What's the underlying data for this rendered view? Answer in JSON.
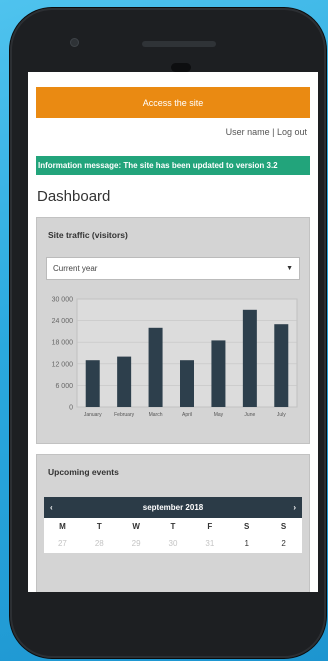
{
  "header": {
    "access_label": "Access the site"
  },
  "user": {
    "name_label": "User name",
    "logout_label": "Log out"
  },
  "info": {
    "message": "Information message: The site has been updated to version 3.2"
  },
  "dashboard": {
    "title": "Dashboard"
  },
  "traffic": {
    "title": "Site traffic (visitors)",
    "period_selected": "Current year"
  },
  "events": {
    "title": "Upcoming events"
  },
  "calendar": {
    "month": "september 2018",
    "prev": "‹",
    "next": "›",
    "weekdays": [
      "M",
      "T",
      "W",
      "T",
      "F",
      "S",
      "S"
    ],
    "days": [
      {
        "d": "27",
        "out": true
      },
      {
        "d": "28",
        "out": true
      },
      {
        "d": "29",
        "out": true
      },
      {
        "d": "30",
        "out": true
      },
      {
        "d": "31",
        "out": true
      },
      {
        "d": "1",
        "out": false
      },
      {
        "d": "2",
        "out": false
      }
    ]
  },
  "colors": {
    "accent": "#ea8a12",
    "info": "#22a47b",
    "bar": "#2d3f4c",
    "calendar_header": "#2b3b47"
  },
  "chart_data": {
    "type": "bar",
    "categories": [
      "January",
      "February",
      "March",
      "April",
      "May",
      "June",
      "July"
    ],
    "values": [
      13000,
      14000,
      22000,
      13000,
      18500,
      27000,
      23000
    ],
    "yticks": [
      0,
      6000,
      12000,
      18000,
      24000,
      30000
    ],
    "ytick_labels": [
      "0",
      "6 000",
      "12 000",
      "18 000",
      "24 000",
      "30 000"
    ],
    "ylim": [
      0,
      30000
    ],
    "grid": true,
    "title": "",
    "xlabel": "",
    "ylabel": ""
  }
}
